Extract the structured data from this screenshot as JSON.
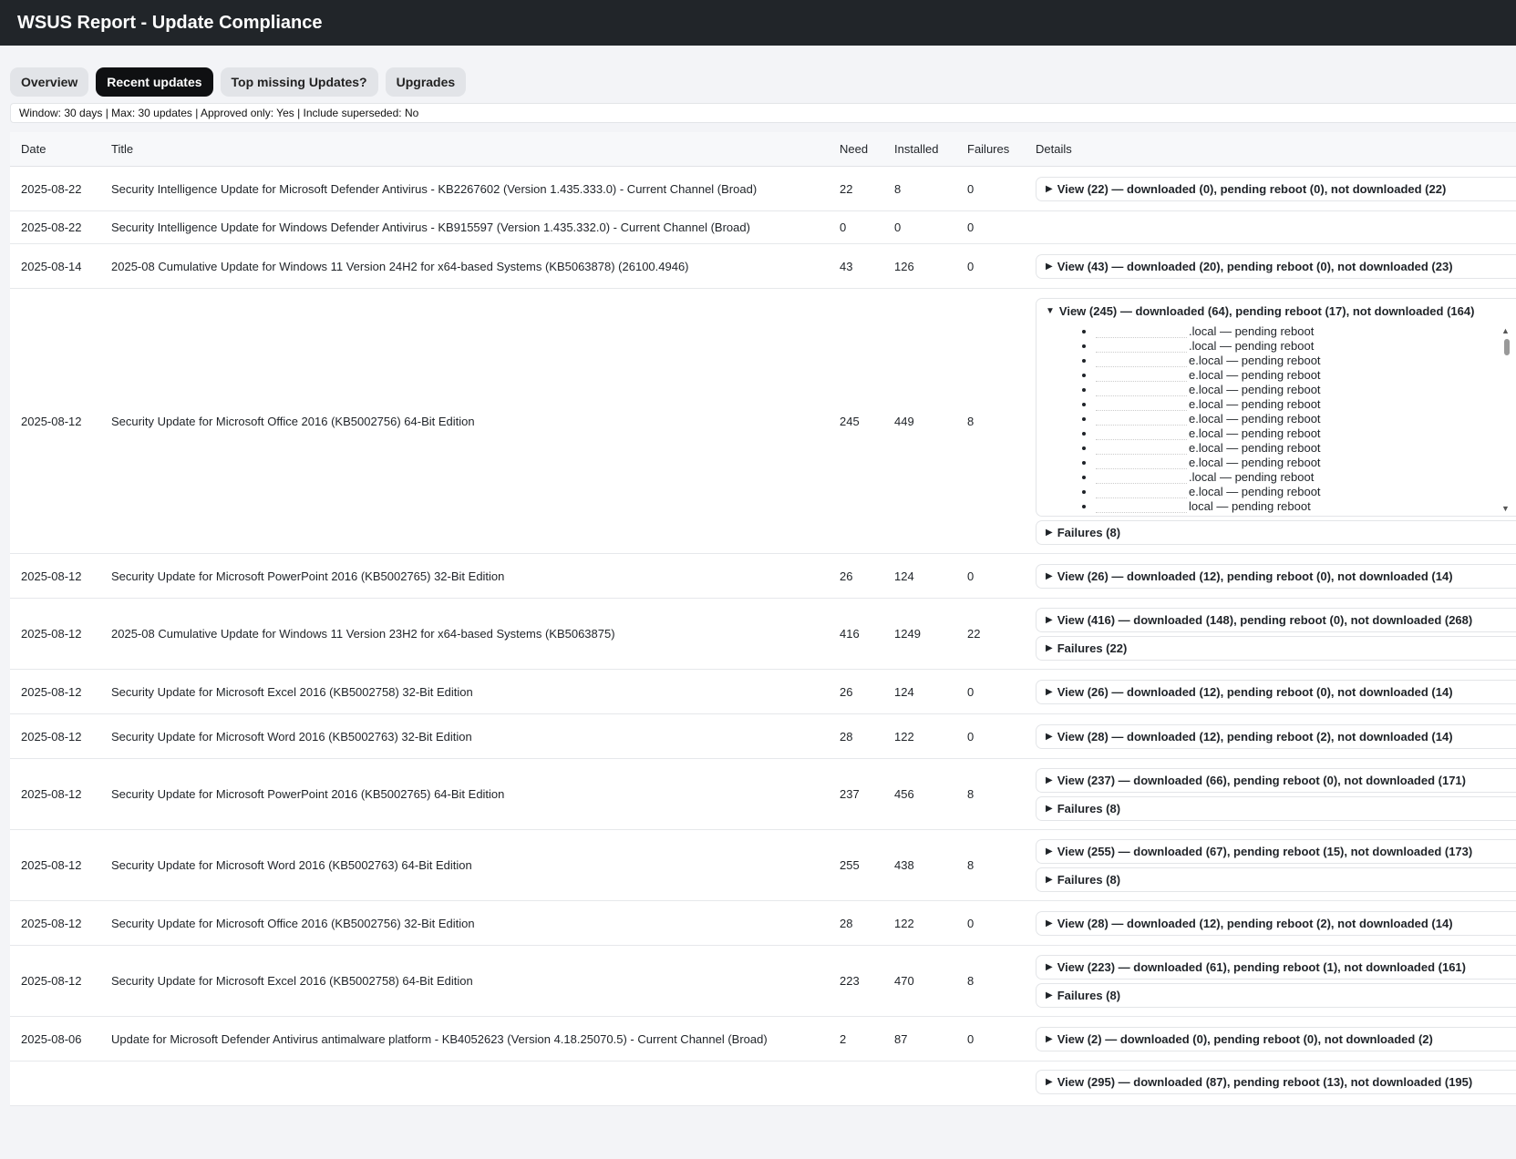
{
  "app": {
    "title": "WSUS Report - Update Compliance"
  },
  "tabs": [
    {
      "label": "Overview",
      "active": false
    },
    {
      "label": "Recent updates",
      "active": true
    },
    {
      "label": "Top missing Updates?",
      "active": false
    },
    {
      "label": "Upgrades",
      "active": false
    }
  ],
  "info_line": "Window: 30 days | Max: 30 updates | Approved only: Yes | Include superseded: No",
  "table": {
    "headers": [
      "Date",
      "Title",
      "Need",
      "Installed",
      "Failures",
      "Details"
    ],
    "rows": [
      {
        "date": "2025-08-22",
        "title": "Security Intelligence Update for Microsoft Defender Antivirus - KB2267602 (Version 1.435.333.0) - Current Channel (Broad)",
        "need": "22",
        "installed": "8",
        "failures": "0",
        "view": "View (22) — downloaded (0), pending reboot (0), not downloaded (22)"
      },
      {
        "date": "2025-08-22",
        "title": "Security Intelligence Update for Windows Defender Antivirus - KB915597 (Version 1.435.332.0) - Current Channel (Broad)",
        "need": "0",
        "installed": "0",
        "failures": "0"
      },
      {
        "date": "2025-08-14",
        "title": "2025-08 Cumulative Update for Windows 11 Version 24H2 for x64-based Systems (KB5063878) (26100.4946)",
        "need": "43",
        "installed": "126",
        "failures": "0",
        "view": "View (43) — downloaded (20), pending reboot (0), not downloaded (23)"
      },
      {
        "date": "2025-08-12",
        "title": "Security Update for Microsoft Office 2016 (KB5002756) 64-Bit Edition",
        "need": "245",
        "installed": "449",
        "failures": "8",
        "view": "View (245) — downloaded (64), pending reboot (17), not downloaded (164)",
        "fail_label": "Failures (8)",
        "hosts": [
          ".local — pending reboot",
          ".local — pending reboot",
          "e.local — pending reboot",
          "e.local — pending reboot",
          "e.local — pending reboot",
          "e.local — pending reboot",
          "e.local — pending reboot",
          "e.local — pending reboot",
          "e.local — pending reboot",
          "e.local — pending reboot",
          ".local — pending reboot",
          "e.local — pending reboot",
          "local — pending reboot"
        ]
      },
      {
        "date": "2025-08-12",
        "title": "Security Update for Microsoft PowerPoint 2016 (KB5002765) 32-Bit Edition",
        "need": "26",
        "installed": "124",
        "failures": "0",
        "view": "View (26) — downloaded (12), pending reboot (0), not downloaded (14)"
      },
      {
        "date": "2025-08-12",
        "title": "2025-08 Cumulative Update for Windows 11 Version 23H2 for x64-based Systems (KB5063875)",
        "need": "416",
        "installed": "1249",
        "failures": "22",
        "view": "View (416) — downloaded (148), pending reboot (0), not downloaded (268)",
        "fail_label": "Failures (22)"
      },
      {
        "date": "2025-08-12",
        "title": "Security Update for Microsoft Excel 2016 (KB5002758) 32-Bit Edition",
        "need": "26",
        "installed": "124",
        "failures": "0",
        "view": "View (26) — downloaded (12), pending reboot (0), not downloaded (14)"
      },
      {
        "date": "2025-08-12",
        "title": "Security Update for Microsoft Word 2016 (KB5002763) 32-Bit Edition",
        "need": "28",
        "installed": "122",
        "failures": "0",
        "view": "View (28) — downloaded (12), pending reboot (2), not downloaded (14)"
      },
      {
        "date": "2025-08-12",
        "title": "Security Update for Microsoft PowerPoint 2016 (KB5002765) 64-Bit Edition",
        "need": "237",
        "installed": "456",
        "failures": "8",
        "view": "View (237) — downloaded (66), pending reboot (0), not downloaded (171)",
        "fail_label": "Failures (8)"
      },
      {
        "date": "2025-08-12",
        "title": "Security Update for Microsoft Word 2016 (KB5002763) 64-Bit Edition",
        "need": "255",
        "installed": "438",
        "failures": "8",
        "view": "View (255) — downloaded (67), pending reboot (15), not downloaded (173)",
        "fail_label": "Failures (8)"
      },
      {
        "date": "2025-08-12",
        "title": "Security Update for Microsoft Office 2016 (KB5002756) 32-Bit Edition",
        "need": "28",
        "installed": "122",
        "failures": "0",
        "view": "View (28) — downloaded (12), pending reboot (2), not downloaded (14)"
      },
      {
        "date": "2025-08-12",
        "title": "Security Update for Microsoft Excel 2016 (KB5002758) 64-Bit Edition",
        "need": "223",
        "installed": "470",
        "failures": "8",
        "view": "View (223) — downloaded (61), pending reboot (1), not downloaded (161)",
        "fail_label": "Failures (8)"
      },
      {
        "date": "2025-08-06",
        "title": "Update for Microsoft Defender Antivirus antimalware platform - KB4052623 (Version 4.18.25070.5) - Current Channel (Broad)",
        "need": "2",
        "installed": "87",
        "failures": "0",
        "view": "View (2) — downloaded (0), pending reboot (0), not downloaded (2)"
      },
      {
        "date": "",
        "title": "",
        "need": "",
        "installed": "",
        "failures": "",
        "view": "View (295) — downloaded (87), pending reboot (13), not downloaded (195)"
      }
    ]
  },
  "icons": {
    "collapsed": "triangle-right-icon",
    "expanded": "triangle-down-icon"
  },
  "colors": {
    "topbar": "#212529",
    "active_tab": "#0f1012",
    "tab": "#e2e4e8"
  }
}
